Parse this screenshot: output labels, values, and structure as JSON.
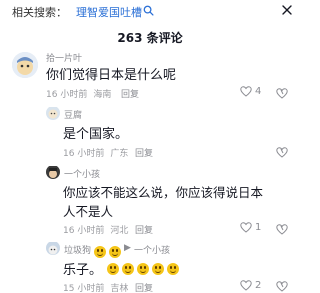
{
  "header": {
    "related_label": "相关搜索：",
    "related_link": "理智爱国吐槽",
    "title": "263 条评论"
  },
  "comments": [
    {
      "username": "拾一片叶",
      "text": "你们觉得日本是什么呢",
      "time": "16 小时前",
      "location": "海南",
      "reply": "回复",
      "likes": "4"
    },
    {
      "username": "豆腐",
      "text": "是个国家。",
      "time": "16 小时前",
      "location": "广东",
      "reply": "回复"
    },
    {
      "username": "一个小孩",
      "text_line1": "你应该不能这么说，你应该得说日本",
      "text_line2": "人不是人",
      "time": "16 小时前",
      "location": "河北",
      "reply": "回复",
      "likes": "1"
    },
    {
      "username": "垃圾狗",
      "reply_to": "一个小孩",
      "text": "乐子。",
      "time": "15 小时前",
      "location": "吉林",
      "reply": "回复",
      "likes": "2"
    }
  ],
  "colors": {
    "link": "#2a6fd6",
    "muted": "#8a8b91",
    "text": "#161823"
  }
}
